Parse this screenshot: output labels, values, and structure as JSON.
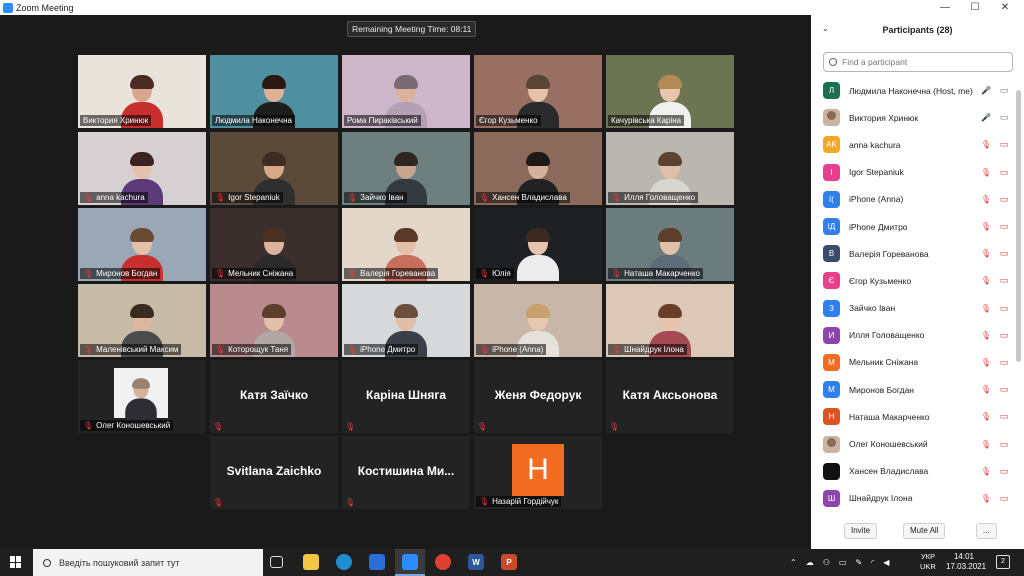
{
  "window": {
    "title": "Zoom Meeting",
    "controls": {
      "minimize": "—",
      "maximize": "☐",
      "close": "✕"
    }
  },
  "meeting": {
    "remaining_time": "Remaining Meeting Time: 08:11"
  },
  "gallery": [
    {
      "name": "Виктория Хринюк",
      "muted": false,
      "bg": "#e9e3dc",
      "skin": "#d8a58d",
      "shirt": "#c8302d",
      "hair": "#4a2c22",
      "video": true
    },
    {
      "name": "Людмила Наконечна",
      "muted": false,
      "bg": "#4e8fa0",
      "skin": "#e0b196",
      "shirt": "#1d1d1d",
      "hair": "#2a1815",
      "video": true,
      "active": true
    },
    {
      "name": "Рома Пиракiвський",
      "muted": false,
      "bg": "#cdb6c9",
      "skin": "#d9b39a",
      "shirt": "#b4a0b5",
      "hair": "#7a6a74",
      "video": true
    },
    {
      "name": "Єгор Кузьменко",
      "muted": false,
      "bg": "#9a6f63",
      "skin": "#e6c2a8",
      "shirt": "#2a2a2a",
      "hair": "#5a4436",
      "video": true
    },
    {
      "name": "Качурiвська Карiна",
      "muted": false,
      "bg": "#6d7452",
      "skin": "#e8c6ae",
      "shirt": "#f0f0ee",
      "hair": "#b28a55",
      "video": true
    },
    {
      "name": "anna kachura",
      "muted": true,
      "bg": "#d7d0d2",
      "skin": "#e6c2ae",
      "shirt": "#5b3a7a",
      "hair": "#3a2320",
      "video": true
    },
    {
      "name": "Igor Stepaniuk",
      "muted": true,
      "bg": "#5b4a3a",
      "skin": "#d8a889",
      "shirt": "#2f2f2f",
      "hair": "#3c2c22",
      "video": true
    },
    {
      "name": "Зайчко Iван",
      "muted": true,
      "bg": "#6d7f7e",
      "skin": "#c9a48e",
      "shirt": "#333a3f",
      "hair": "#2e2721",
      "video": true
    },
    {
      "name": "Хансен Владислава",
      "muted": true,
      "bg": "#8c6a5b",
      "skin": "#d6b09a",
      "shirt": "#222222",
      "hair": "#1e1a18",
      "video": true
    },
    {
      "name": "Илля Головащенко",
      "muted": true,
      "bg": "#b9b7b0",
      "skin": "#e0c0a8",
      "shirt": "#d9d6d0",
      "hair": "#5b4332",
      "video": true
    },
    {
      "name": "Миронов Богдан",
      "muted": true,
      "bg": "#9aa7b6",
      "skin": "#e4c2a8",
      "shirt": "#c8302d",
      "hair": "#6b4a32",
      "video": true
    },
    {
      "name": "Мельник Снiжана",
      "muted": true,
      "bg": "#3a2f2c",
      "skin": "#dcb39c",
      "shirt": "#2a2a2a",
      "hair": "#4a2f23",
      "video": true
    },
    {
      "name": "Валерiя Горевановa",
      "muted": true,
      "bg": "#e2d7c9",
      "skin": "#e2bfa6",
      "shirt": "#c76f5d",
      "hair": "#5a3a28",
      "video": true
    },
    {
      "name": "Юлiя",
      "muted": true,
      "bg": "#1f2023",
      "skin": "#e3c3ad",
      "shirt": "#ececec",
      "hair": "#3a2a22",
      "video": true
    },
    {
      "name": "Наташа Макарченко",
      "muted": true,
      "bg": "#6a7c7e",
      "skin": "#e2c1ab",
      "shirt": "#5f6b78",
      "hair": "#5e3e2b",
      "video": true
    },
    {
      "name": "Маленiвський Максим",
      "muted": true,
      "bg": "#c7bba8",
      "skin": "#dcb69f",
      "shirt": "#4b4b4b",
      "hair": "#3a2a20",
      "video": true
    },
    {
      "name": "Которощук Таня",
      "muted": true,
      "bg": "#b98a8e",
      "skin": "#e3c0aa",
      "shirt": "#b3a7a3",
      "hair": "#5c3e2d",
      "video": true
    },
    {
      "name": "iPhone Дмитро",
      "muted": true,
      "bg": "#d6d8da",
      "skin": "#e2bea6",
      "shirt": "#3b4048",
      "hair": "#6b4e3b",
      "video": true
    },
    {
      "name": "iPhone (Anna)",
      "muted": true,
      "bg": "#c8b6a8",
      "skin": "#e6c7b1",
      "shirt": "#e6e1da",
      "hair": "#c7a06c",
      "video": true
    },
    {
      "name": "Шнайдрук Iлона",
      "muted": true,
      "bg": "#dcc8b6",
      "skin": "#e6c3aa",
      "shirt": "#a54a52",
      "hair": "#6a3f2a",
      "video": true
    },
    {
      "name": "Олег Коношевський",
      "muted": true,
      "bg": "#f1f1f1",
      "skin": "#d7b29b",
      "shirt": "#2d2d33",
      "hair": "#9a8373",
      "video": true,
      "small": true
    },
    {
      "name": "Катя Заїчко",
      "muted": true,
      "video": false
    },
    {
      "name": "Карiна Шняга",
      "muted": true,
      "video": false
    },
    {
      "name": "Женя Федорук",
      "muted": true,
      "video": false
    },
    {
      "name": "Катя Аксьонова",
      "muted": true,
      "video": false
    },
    {
      "name": "Svitlana Zaichko",
      "muted": true,
      "video": false
    },
    {
      "name": "Костишина Ми...",
      "muted": true,
      "video": false
    },
    {
      "name": "Назарiй Гордiйчук",
      "muted": true,
      "video": false,
      "letter": "Н"
    }
  ],
  "participants": {
    "title": "Participants (28)",
    "search_placeholder": "Find a participant",
    "list": [
      {
        "name": "Людмила Наконечна (Host, me)",
        "initials": "Л",
        "color": "#1e6f4f",
        "mic": "on",
        "cam": "on"
      },
      {
        "name": "Виктория Хринюк",
        "initials": "",
        "color": "photo",
        "mic": "on",
        "cam": "on"
      },
      {
        "name": "anna kachura",
        "initials": "AK",
        "color": "#f5a623",
        "mic": "off",
        "cam": "off"
      },
      {
        "name": "Igor Stepaniuk",
        "initials": "I",
        "color": "#e83e8c",
        "mic": "off",
        "cam": "off"
      },
      {
        "name": "iPhone (Anna)",
        "initials": "I(",
        "color": "#2f80ed",
        "mic": "off",
        "cam": "off"
      },
      {
        "name": "iPhone Дмитро",
        "initials": "IД",
        "color": "#2f80ed",
        "mic": "off",
        "cam": "off"
      },
      {
        "name": "Валерiя Гореванова",
        "initials": "В",
        "color": "#3a4b6e",
        "mic": "off",
        "cam": "off"
      },
      {
        "name": "Єгор Кузьменко",
        "initials": "Є",
        "color": "#e83e8c",
        "mic": "off",
        "cam": "off"
      },
      {
        "name": "Зайчко Iван",
        "initials": "З",
        "color": "#2f80ed",
        "mic": "off",
        "cam": "off"
      },
      {
        "name": "Илля Головащенко",
        "initials": "И",
        "color": "#8e44ad",
        "mic": "off",
        "cam": "off"
      },
      {
        "name": "Мельник Снiжана",
        "initials": "М",
        "color": "#f26d21",
        "mic": "off",
        "cam": "off"
      },
      {
        "name": "Миронов Богдан",
        "initials": "М",
        "color": "#2f80ed",
        "mic": "off",
        "cam": "off"
      },
      {
        "name": "Наташа Макарченко",
        "initials": "Н",
        "color": "#e0531f",
        "mic": "off",
        "cam": "off"
      },
      {
        "name": "Олег Коношевський",
        "initials": "",
        "color": "photo",
        "mic": "off",
        "cam": "offstrike"
      },
      {
        "name": "Хансен Владислава",
        "initials": "",
        "color": "#111111",
        "mic": "off",
        "cam": "off"
      },
      {
        "name": "Шнайдрук Iлона",
        "initials": "Ш",
        "color": "#8e44ad",
        "mic": "off",
        "cam": "off"
      }
    ],
    "invite_label": "Invite",
    "mute_all_label": "Mute All",
    "more_label": "..."
  },
  "taskbar": {
    "search_placeholder": "Введiть пошуковий запит тут",
    "lang_top": "УКР",
    "lang_bottom": "UKR",
    "time": "14:01",
    "date": "17.03.2021",
    "notifications": "2",
    "apps": [
      {
        "name": "task-view",
        "label": "",
        "color": "#1f1f1f"
      },
      {
        "name": "file-explorer",
        "label": "",
        "color": "#f2c744"
      },
      {
        "name": "edge",
        "label": "",
        "color": "#1f8ecf"
      },
      {
        "name": "mail",
        "label": "",
        "color": "#2a6fd6"
      },
      {
        "name": "zoom",
        "label": "",
        "color": "#2d8cff"
      },
      {
        "name": "chrome",
        "label": "",
        "color": "#de4032"
      },
      {
        "name": "word",
        "label": "W",
        "color": "#2b579a"
      },
      {
        "name": "powerpoint",
        "label": "P",
        "color": "#c84b29"
      }
    ]
  }
}
